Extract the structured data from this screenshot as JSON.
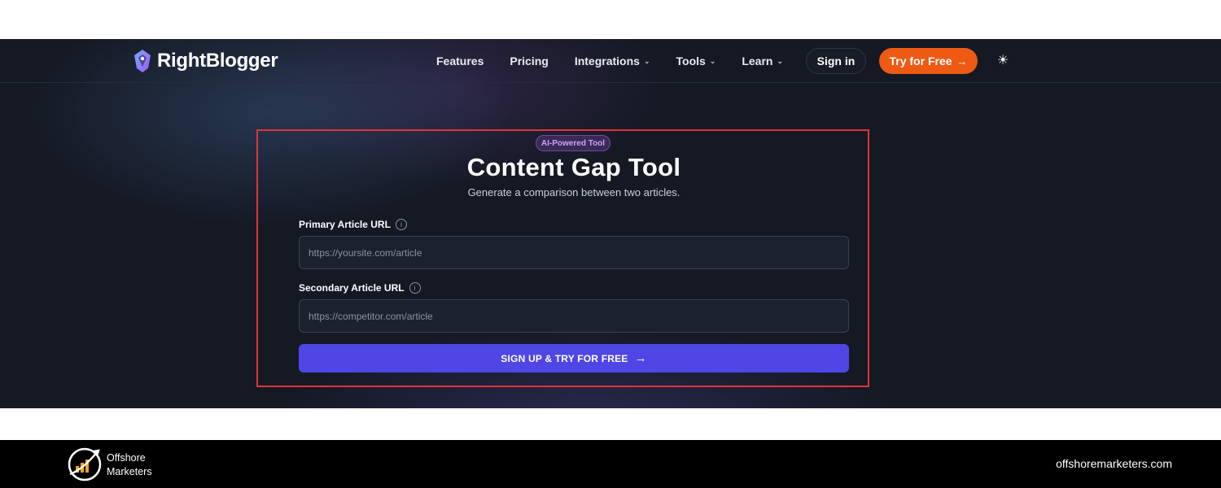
{
  "nav": {
    "brand": "RightBlogger",
    "links": [
      {
        "label": "Features",
        "has_dropdown": false
      },
      {
        "label": "Pricing",
        "has_dropdown": false
      },
      {
        "label": "Integrations",
        "has_dropdown": true
      },
      {
        "label": "Tools",
        "has_dropdown": true
      },
      {
        "label": "Learn",
        "has_dropdown": true
      }
    ],
    "signin_label": "Sign in",
    "try_label": "Try for Free",
    "theme_icon": "sun-icon"
  },
  "tool": {
    "badge": "AI-Powered Tool",
    "title": "Content Gap Tool",
    "subtitle": "Generate a comparison between two articles.",
    "primary_label": "Primary Article URL",
    "primary_placeholder": "https://yoursite.com/article",
    "secondary_label": "Secondary Article URL",
    "secondary_placeholder": "https://competitor.com/article",
    "cta_label": "SIGN UP & TRY FOR FREE"
  },
  "footer": {
    "brand_line1": "Offshore",
    "brand_line2": "Marketers",
    "site": "offshoremarketers.com"
  },
  "colors": {
    "accent_orange": "#ee5a13",
    "accent_indigo": "#4f46e5",
    "highlight_red": "#e0343a",
    "bg_dark": "#151924"
  }
}
